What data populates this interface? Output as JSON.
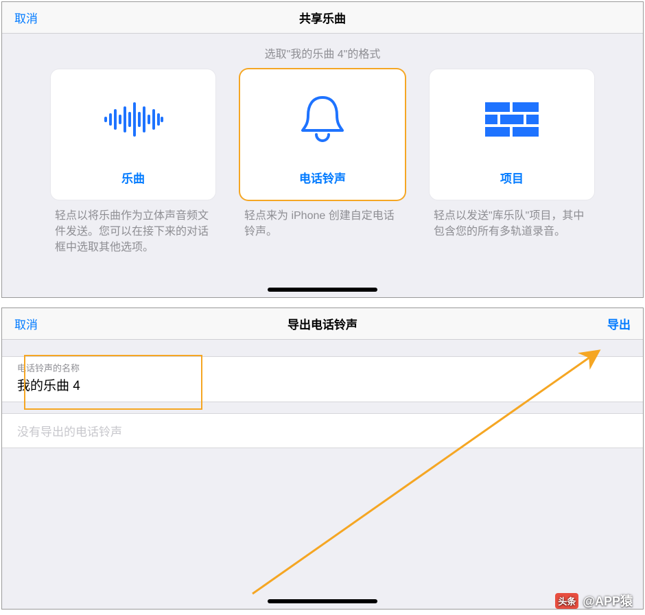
{
  "panel1": {
    "cancel": "取消",
    "title": "共享乐曲",
    "subtitle": "选取\"我的乐曲 4\"的格式",
    "cards": [
      {
        "label": "乐曲",
        "desc": "轻点以将乐曲作为立体声音频文件发送。您可以在接下来的对话框中选取其他选项。",
        "selected": false
      },
      {
        "label": "电话铃声",
        "desc": "轻点来为 iPhone 创建自定电话铃声。",
        "selected": true
      },
      {
        "label": "项目",
        "desc": "轻点以发送\"库乐队\"项目，其中包含您的所有多轨道录音。",
        "selected": false
      }
    ]
  },
  "panel2": {
    "cancel": "取消",
    "title": "导出电话铃声",
    "export": "导出",
    "fieldLabel": "电话铃声的名称",
    "fieldValue": "我的乐曲 4",
    "emptyRow": "没有导出的电话铃声"
  },
  "watermark": {
    "prefix": "头条",
    "author": "@APP猿"
  },
  "colors": {
    "accent": "#007aff",
    "highlight": "#f5a623"
  }
}
